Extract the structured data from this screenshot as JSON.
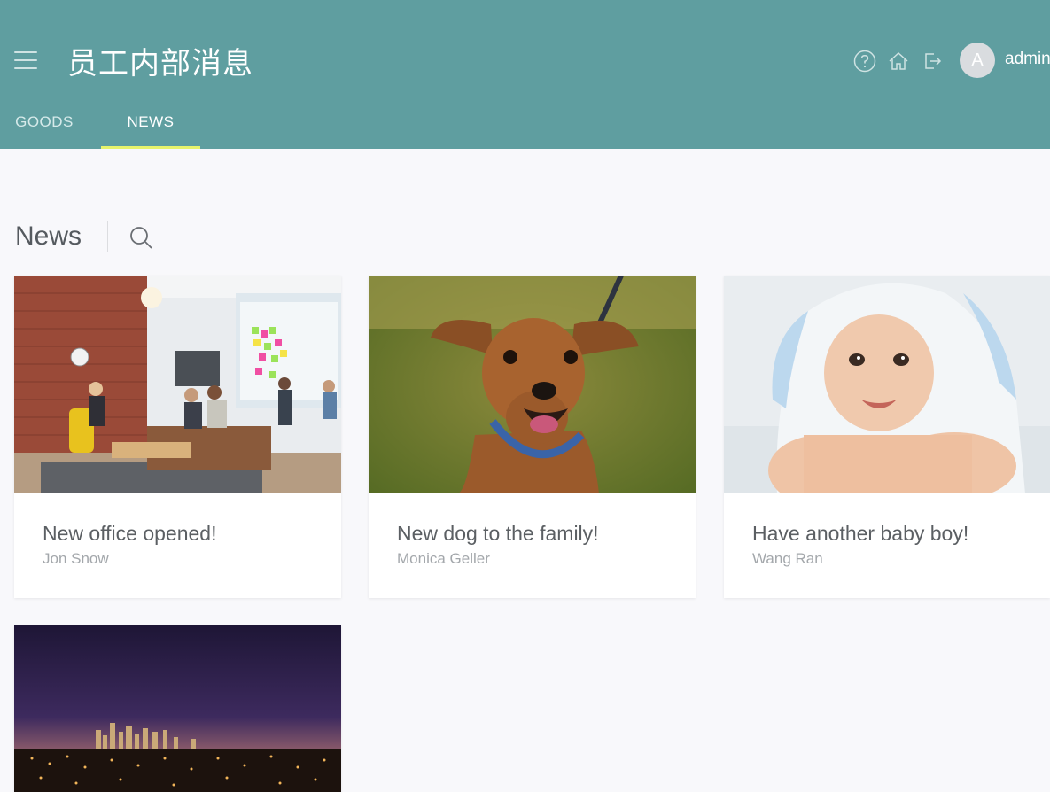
{
  "header": {
    "app_title": "员工内部消息",
    "avatar_initial": "A",
    "username": "admin"
  },
  "tabs": [
    {
      "label": "GOODS",
      "active": false
    },
    {
      "label": "NEWS",
      "active": true
    }
  ],
  "main": {
    "section_title": "News"
  },
  "news": [
    {
      "title": "New office opened!",
      "author": "Jon Snow",
      "image": "office-lounge-photo"
    },
    {
      "title": "New dog to the family!",
      "author": "Monica Geller",
      "image": "brown-dog-photo"
    },
    {
      "title": "Have another baby boy!",
      "author": "Wang Ran",
      "image": "baby-in-towel-photo"
    },
    {
      "title": "",
      "author": "",
      "image": "city-night-skyline-photo"
    }
  ],
  "colors": {
    "header_bg": "#5f9ea0",
    "tab_indicator": "#e7f46c",
    "page_bg": "#f8f8fb"
  }
}
